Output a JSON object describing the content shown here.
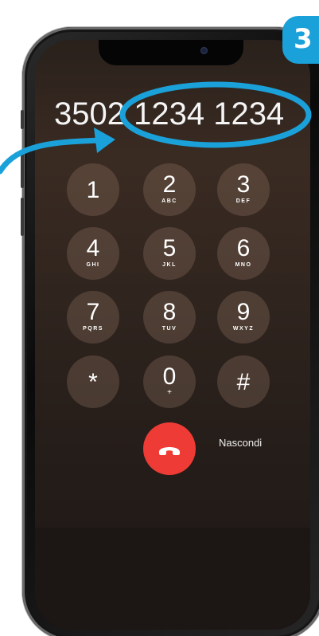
{
  "step_badge": "3",
  "dialed_number": "3502 1234 1234",
  "keypad": [
    {
      "digit": "1",
      "letters": ""
    },
    {
      "digit": "2",
      "letters": "ABC"
    },
    {
      "digit": "3",
      "letters": "DEF"
    },
    {
      "digit": "4",
      "letters": "GHI"
    },
    {
      "digit": "5",
      "letters": "JKL"
    },
    {
      "digit": "6",
      "letters": "MNO"
    },
    {
      "digit": "7",
      "letters": "PQRS"
    },
    {
      "digit": "8",
      "letters": "TUV"
    },
    {
      "digit": "9",
      "letters": "WXYZ"
    },
    {
      "digit": "*",
      "letters": ""
    },
    {
      "digit": "0",
      "letters": "+"
    },
    {
      "digit": "#",
      "letters": ""
    }
  ],
  "hide_label": "Nascondi",
  "colors": {
    "accent": "#1ba1d9",
    "call_red": "#ef3b36"
  },
  "icons": {
    "call": "phone-hangup-icon",
    "arrow": "pointer-arrow-icon",
    "highlight": "ellipse-highlight"
  }
}
